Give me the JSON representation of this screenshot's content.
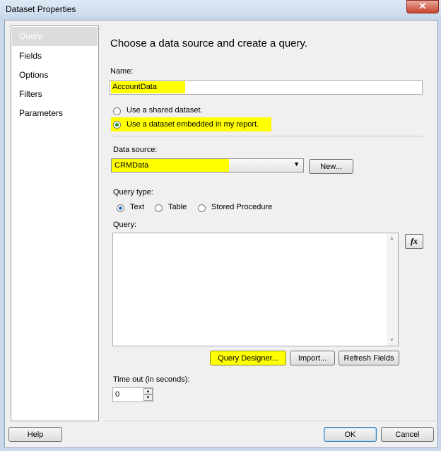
{
  "window": {
    "title": "Dataset Properties",
    "close_glyph": "✕"
  },
  "sidebar": {
    "items": [
      {
        "label": "Query",
        "selected": true
      },
      {
        "label": "Fields"
      },
      {
        "label": "Options"
      },
      {
        "label": "Filters"
      },
      {
        "label": "Parameters"
      }
    ]
  },
  "page": {
    "heading": "Choose a data source and create a query.",
    "name_label": "Name:",
    "name_value": "AccountData",
    "dataset_options": [
      {
        "label": "Use a shared dataset.",
        "selected": false
      },
      {
        "label": "Use a dataset embedded in my report.",
        "selected": true
      }
    ],
    "data_source_label": "Data source:",
    "data_source_value": "CRMData",
    "new_button": "New...",
    "query_type_label": "Query type:",
    "query_types": [
      {
        "label": "Text",
        "selected": true
      },
      {
        "label": "Table",
        "selected": false
      },
      {
        "label": "Stored Procedure",
        "selected": false
      }
    ],
    "query_label": "Query:",
    "query_value": "",
    "fx_label": "fx",
    "query_designer_button": "Query Designer...",
    "import_button": "Import...",
    "refresh_fields_button": "Refresh Fields",
    "timeout_label": "Time out (in seconds):",
    "timeout_value": "0"
  },
  "footer": {
    "help": "Help",
    "ok": "OK",
    "cancel": "Cancel"
  },
  "colors": {
    "highlight": "#ffff00",
    "title_bar": "#c6d6e9",
    "close": "#c7432d"
  }
}
